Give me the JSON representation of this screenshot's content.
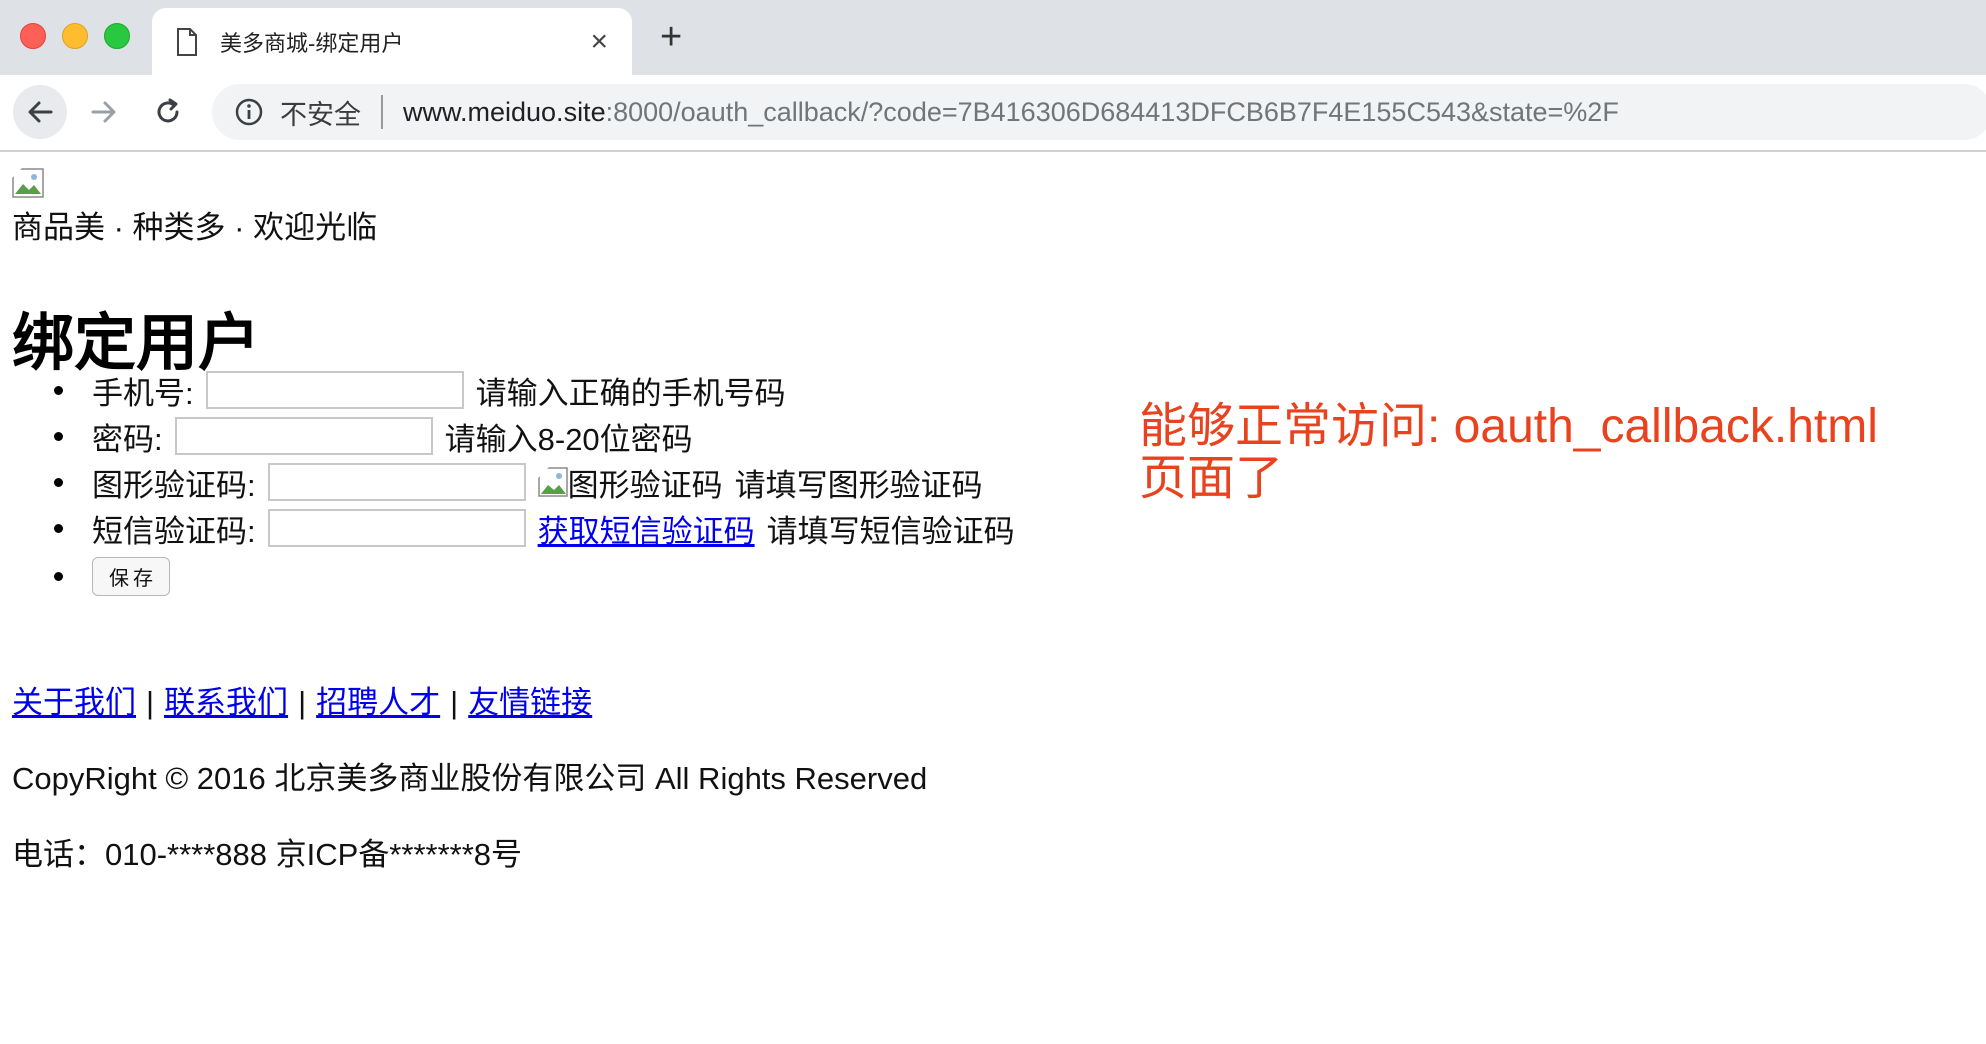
{
  "browser": {
    "tab_title": "美多商城-绑定用户",
    "new_tab_label": "+",
    "close_glyph": "×",
    "security_label": "不安全",
    "url_host": "www.meiduo.site",
    "url_rest": ":8000/oauth_callback/?code=7B416306D684413DFCB6B7F4E155C543&state=%2F",
    "icons": [
      "back-arrow-icon",
      "forward-arrow-icon",
      "reload-icon",
      "info-icon",
      "document-icon",
      "close-icon"
    ]
  },
  "header": {
    "slogan": "商品美 · 种类多 · 欢迎光临"
  },
  "main": {
    "title": "绑定用户",
    "form": {
      "phone_label": "手机号:",
      "phone_hint": "请输入正确的手机号码",
      "password_label": "密码:",
      "password_hint": "请输入8-20位密码",
      "captcha_label": "图形验证码:",
      "captcha_img_alt": "图形验证码",
      "captcha_hint": "请填写图形验证码",
      "sms_label": "短信验证码:",
      "sms_link": "获取短信验证码",
      "sms_hint": "请填写短信验证码",
      "save_label": "保存"
    }
  },
  "footer": {
    "links": [
      "关于我们",
      "联系我们",
      "招聘人才",
      "友情链接"
    ],
    "separator": "|",
    "copyright": "CopyRight © 2016 北京美多商业股份有限公司 All Rights Reserved",
    "phone": "电话：010-****888 京ICP备*******8号"
  },
  "annotation": {
    "line1": "能够正常访问: oauth_callback.html",
    "line2": "页面了",
    "color": "#e8431e"
  }
}
